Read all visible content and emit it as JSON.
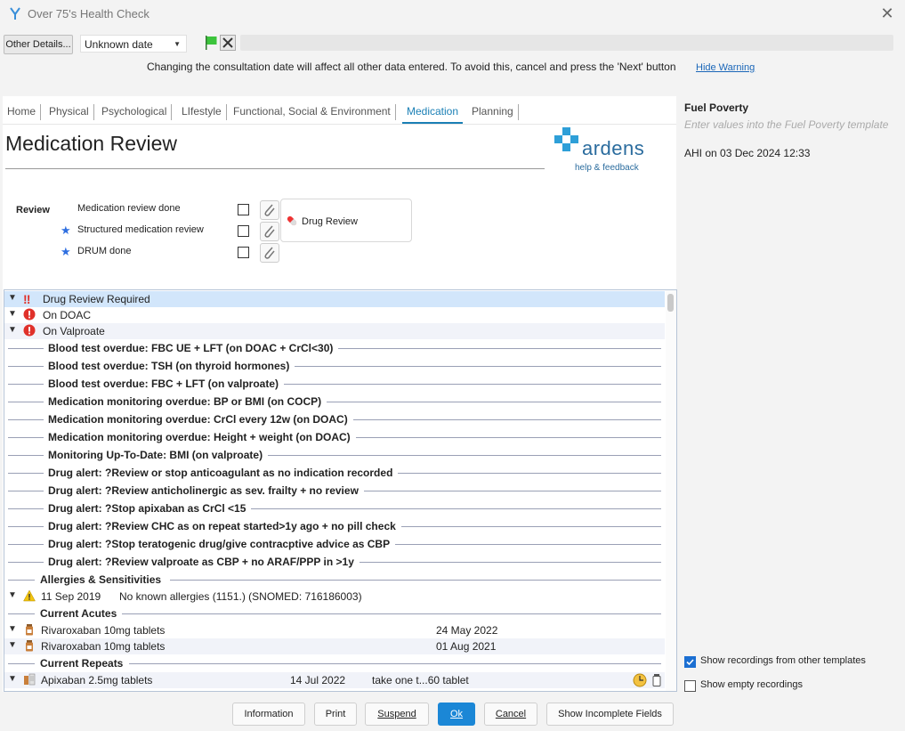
{
  "window": {
    "title": "Over 75's Health Check"
  },
  "toolbar": {
    "other_details": "Other Details...",
    "date_value": "Unknown date"
  },
  "warning": {
    "message": "Changing the consultation date will affect all other data entered. To avoid this, cancel and press the 'Next' button",
    "hide_link": "Hide Warning"
  },
  "tabs": [
    "Home",
    "Physical",
    "Psychological",
    "LIfestyle",
    "Functional, Social & Environment",
    "Medication",
    "Planning"
  ],
  "active_tab": "Medication",
  "page": {
    "title": "Medication Review"
  },
  "logo": {
    "word": "ardens",
    "sub": "help & feedback"
  },
  "review": {
    "label": "Review",
    "items": [
      {
        "label": "Medication review done",
        "starred": false
      },
      {
        "label": "Structured medication review",
        "starred": true
      },
      {
        "label": "DRUM done",
        "starred": true
      }
    ],
    "drug_review_button": "Drug Review"
  },
  "alerts": [
    {
      "text": "Drug Review Required",
      "icon": "double-exclamation-icon"
    },
    {
      "text": "On DOAC",
      "icon": "red-exclamation-icon"
    },
    {
      "text": "On Valproate",
      "icon": "red-exclamation-icon"
    }
  ],
  "bold_items": [
    "Blood test overdue: FBC UE + LFT (on DOAC + CrCl<30)",
    "Blood test overdue: TSH (on thyroid hormones)",
    "Blood test overdue: FBC + LFT (on valproate)",
    "Medication monitoring overdue: BP or BMI (on COCP)",
    "Medication monitoring overdue: CrCl every 12w (on DOAC)",
    "Medication monitoring overdue: Height + weight (on DOAC)",
    "Monitoring Up-To-Date: BMI (on valproate)",
    "Drug alert: ?Review or stop anticoagulant as no indication recorded",
    "Drug alert: ?Review anticholinergic as sev. frailty + no review",
    "Drug alert: ?Stop apixaban as CrCl <15",
    "Drug alert: ?Review CHC as on repeat started>1y ago + no pill check",
    "Drug alert: ?Stop teratogenic drug/give contracptive advice as CBP",
    "Drug alert: ?Review valproate as CBP + no ARAF/PPP in >1y"
  ],
  "sections": {
    "allergies": "Allergies & Sensitivities",
    "acutes": "Current Acutes",
    "repeats": "Current Repeats"
  },
  "allergy": {
    "date": "11 Sep 2019",
    "text": "No known allergies (1151.) (SNOMED: 716186003)"
  },
  "acutes": [
    {
      "name": "Rivaroxaban 10mg tablets",
      "date": "24 May 2022"
    },
    {
      "name": "Rivaroxaban 10mg tablets",
      "date": "01 Aug 2021"
    }
  ],
  "repeats": [
    {
      "name": "Apixaban 2.5mg tablets",
      "date": "14 Jul 2022",
      "dose": "take one t...60 tablet"
    }
  ],
  "right": {
    "title": "Fuel Poverty",
    "subtitle": "Enter values into the Fuel Poverty template",
    "info": "AHI on 03 Dec 2024 12:33",
    "show_other": "Show recordings from other templates",
    "show_empty": "Show empty recordings",
    "show_other_checked": true,
    "show_empty_checked": false
  },
  "buttons": {
    "information": "Information",
    "print": "Print",
    "suspend": "Suspend",
    "ok": "Ok",
    "cancel": "Cancel",
    "incomplete": "Show Incomplete Fields"
  },
  "colors": {
    "accent": "#1a7fb5",
    "primary_button": "#1b87d6",
    "alert_red": "#e0312a"
  }
}
